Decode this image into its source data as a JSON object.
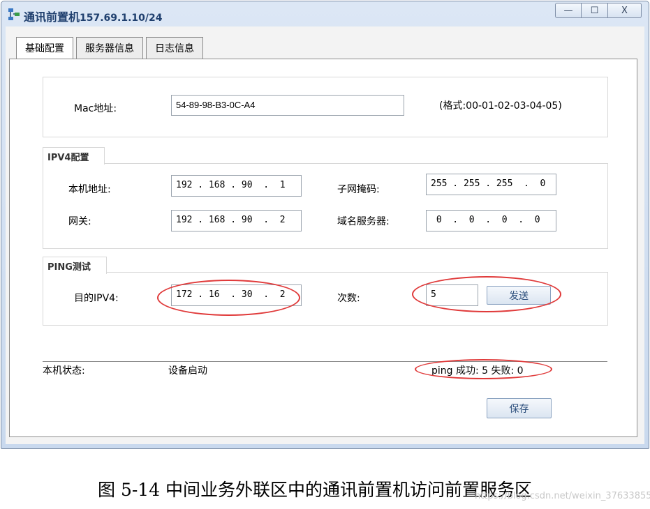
{
  "window": {
    "title": "通讯前置机",
    "title_ip": "157.69.1.10/24",
    "minimize_symbol": "—",
    "maximize_symbol": "☐",
    "close_symbol": "X"
  },
  "tabs": [
    {
      "label": "基础配置",
      "active": true
    },
    {
      "label": "服务器信息",
      "active": false
    },
    {
      "label": "日志信息",
      "active": false
    }
  ],
  "mac": {
    "label": "Mac地址:",
    "value": "54-89-98-B3-0C-A4",
    "format_hint": "(格式:00-01-02-03-04-05)"
  },
  "ipv4": {
    "group_title": "IPV4配置",
    "local_ip_label": "本机地址:",
    "local_ip": "192 . 168 . 90  .  1",
    "subnet_label": "子网掩码:",
    "subnet": "255 . 255 . 255  .  0",
    "gateway_label": "网关:",
    "gateway": "192 . 168 . 90  .  2",
    "dns_label": "域名服务器:",
    "dns": " 0  .  0  .  0  .  0"
  },
  "ping": {
    "group_title": "PING测试",
    "target_label": "目的IPV4:",
    "target": "172 . 16  . 30  .  2",
    "count_label": "次数:",
    "count": "5",
    "send_label": "发送"
  },
  "status": {
    "label": "本机状态:",
    "value": "设备启动",
    "result": "ping 成功: 5   失败: 0"
  },
  "save_label": "保存",
  "caption": "图 5-14 中间业务外联区中的通讯前置机访问前置服务区",
  "watermark": "https://blog.csdn.net/weixin_37633855",
  "colors": {
    "annotation": "#e03a3a",
    "title": "#1f3f6e"
  }
}
